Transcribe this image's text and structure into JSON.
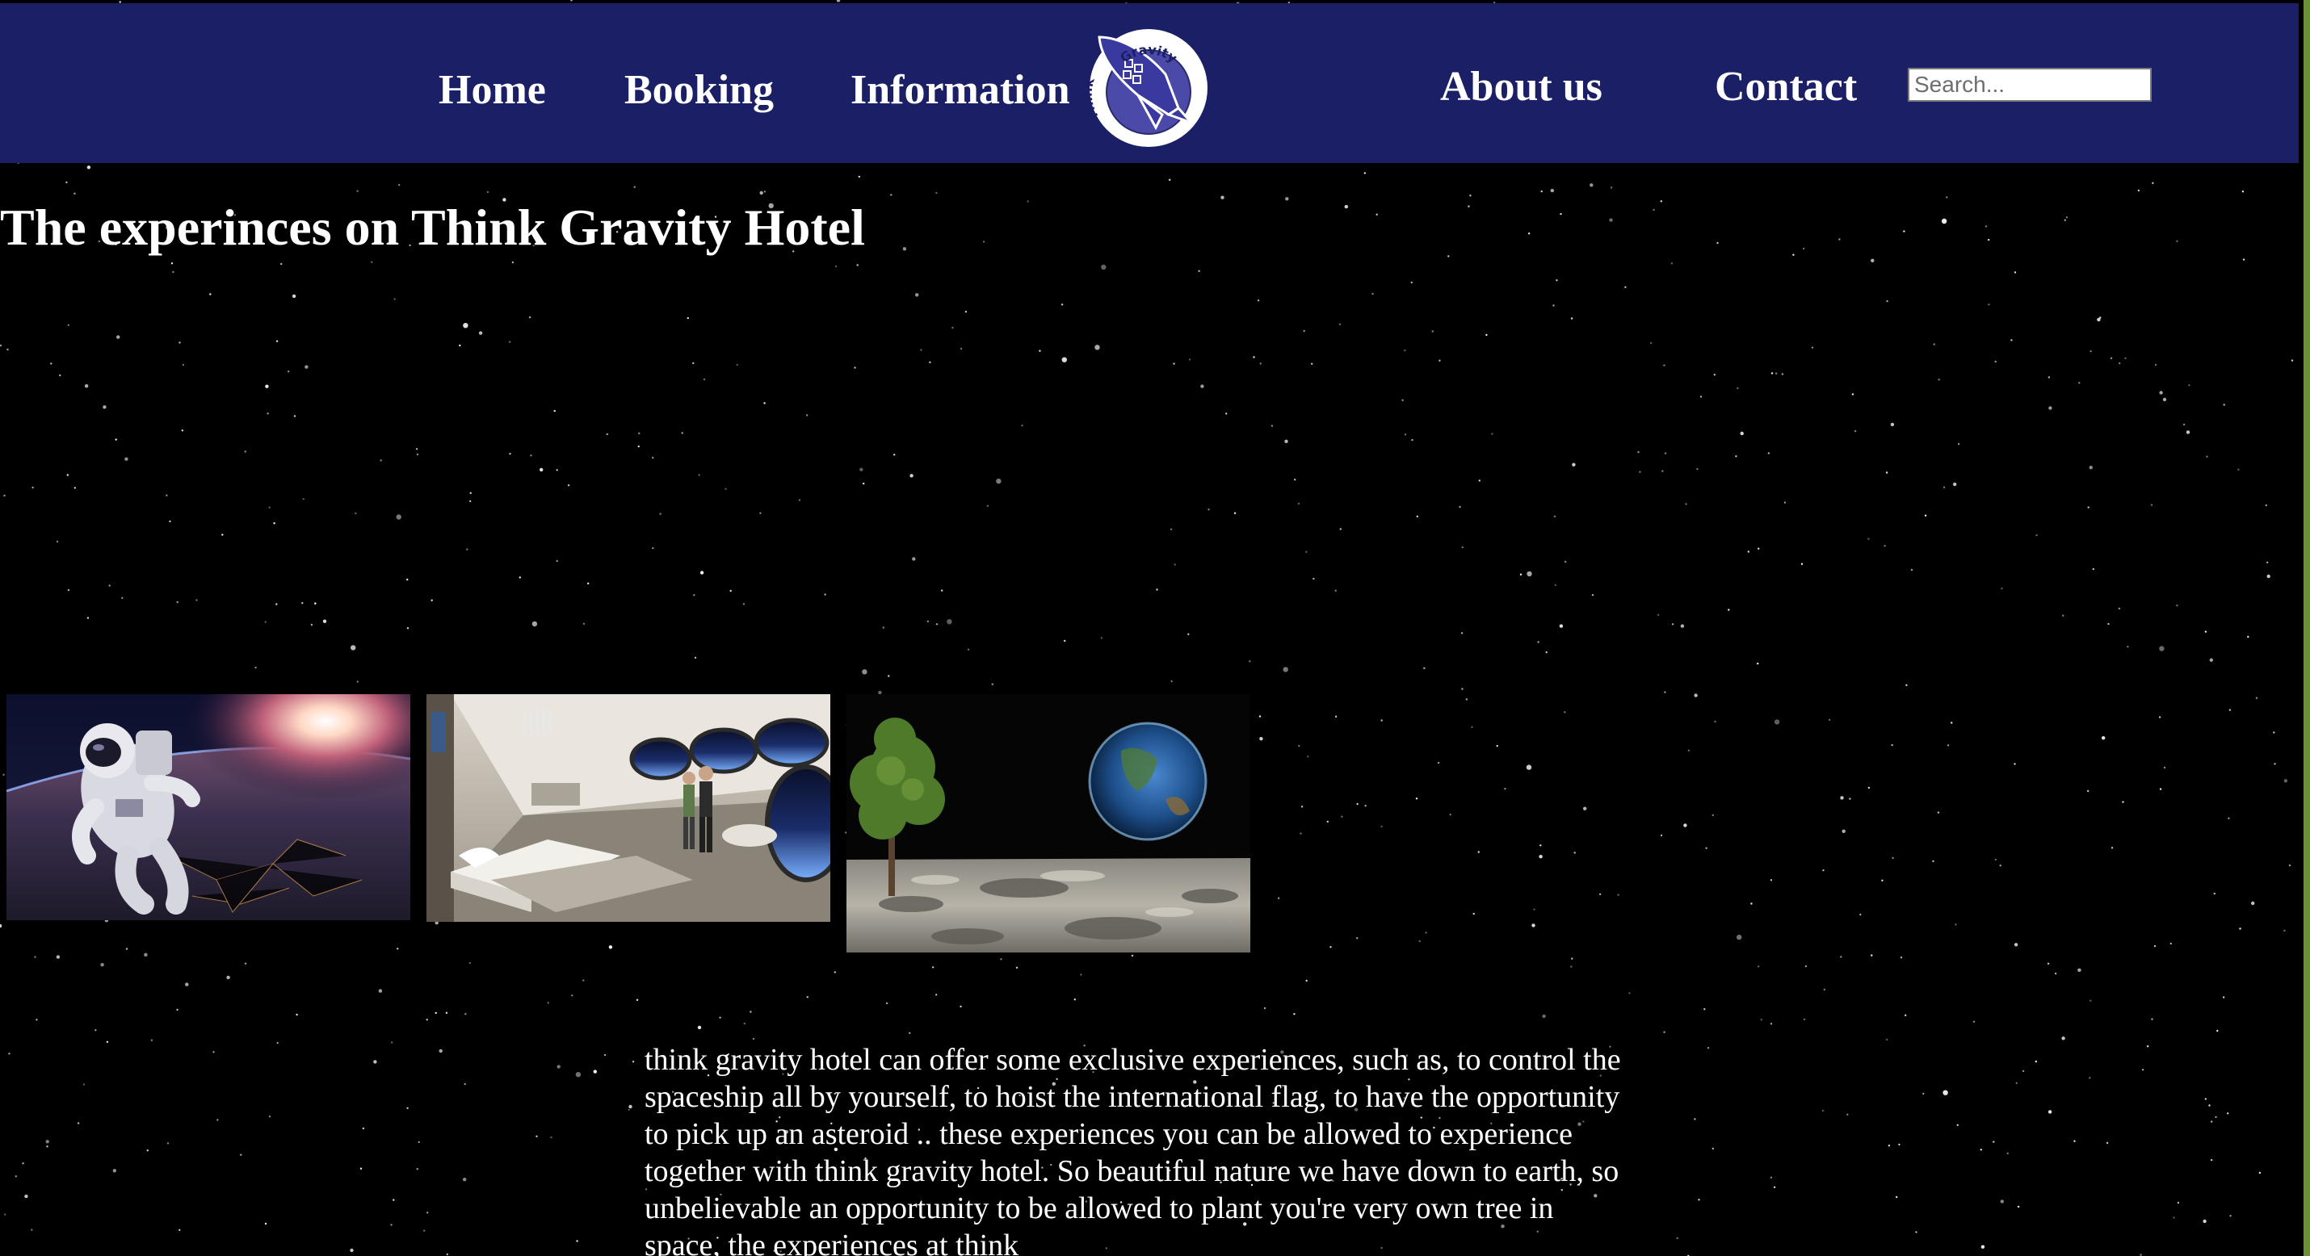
{
  "nav": {
    "items": [
      {
        "label": "Home"
      },
      {
        "label": "Booking"
      },
      {
        "label": "Information"
      },
      {
        "label": "About us"
      },
      {
        "label": "Contact"
      }
    ],
    "logo": {
      "ring_text_top": "Gravity",
      "ring_text_left": "Think"
    }
  },
  "search": {
    "placeholder": "Search...",
    "value": ""
  },
  "main": {
    "title": "The experinces on Think Gravity Hotel",
    "images": [
      {
        "subject": "astronaut-in-orbit"
      },
      {
        "subject": "hotel-room-with-earth-view"
      },
      {
        "subject": "tree-on-moon-with-earth"
      }
    ],
    "description": "think gravity hotel can offer some exclusive experiences, such as, to control the spaceship all by yourself, to hoist the international flag, to have the opportunity to pick up an asteroid .. these experiences you can be allowed to experience together with think gravity hotel. So beautiful nature we have down to earth, so unbelievable an opportunity to be allowed to plant you're very own tree in space, the experiences at think"
  },
  "colors": {
    "navbar_bg": "#1b1f66",
    "page_bg": "#000000",
    "text": "#ffffff",
    "logo_fill": "#4b4aa8"
  }
}
